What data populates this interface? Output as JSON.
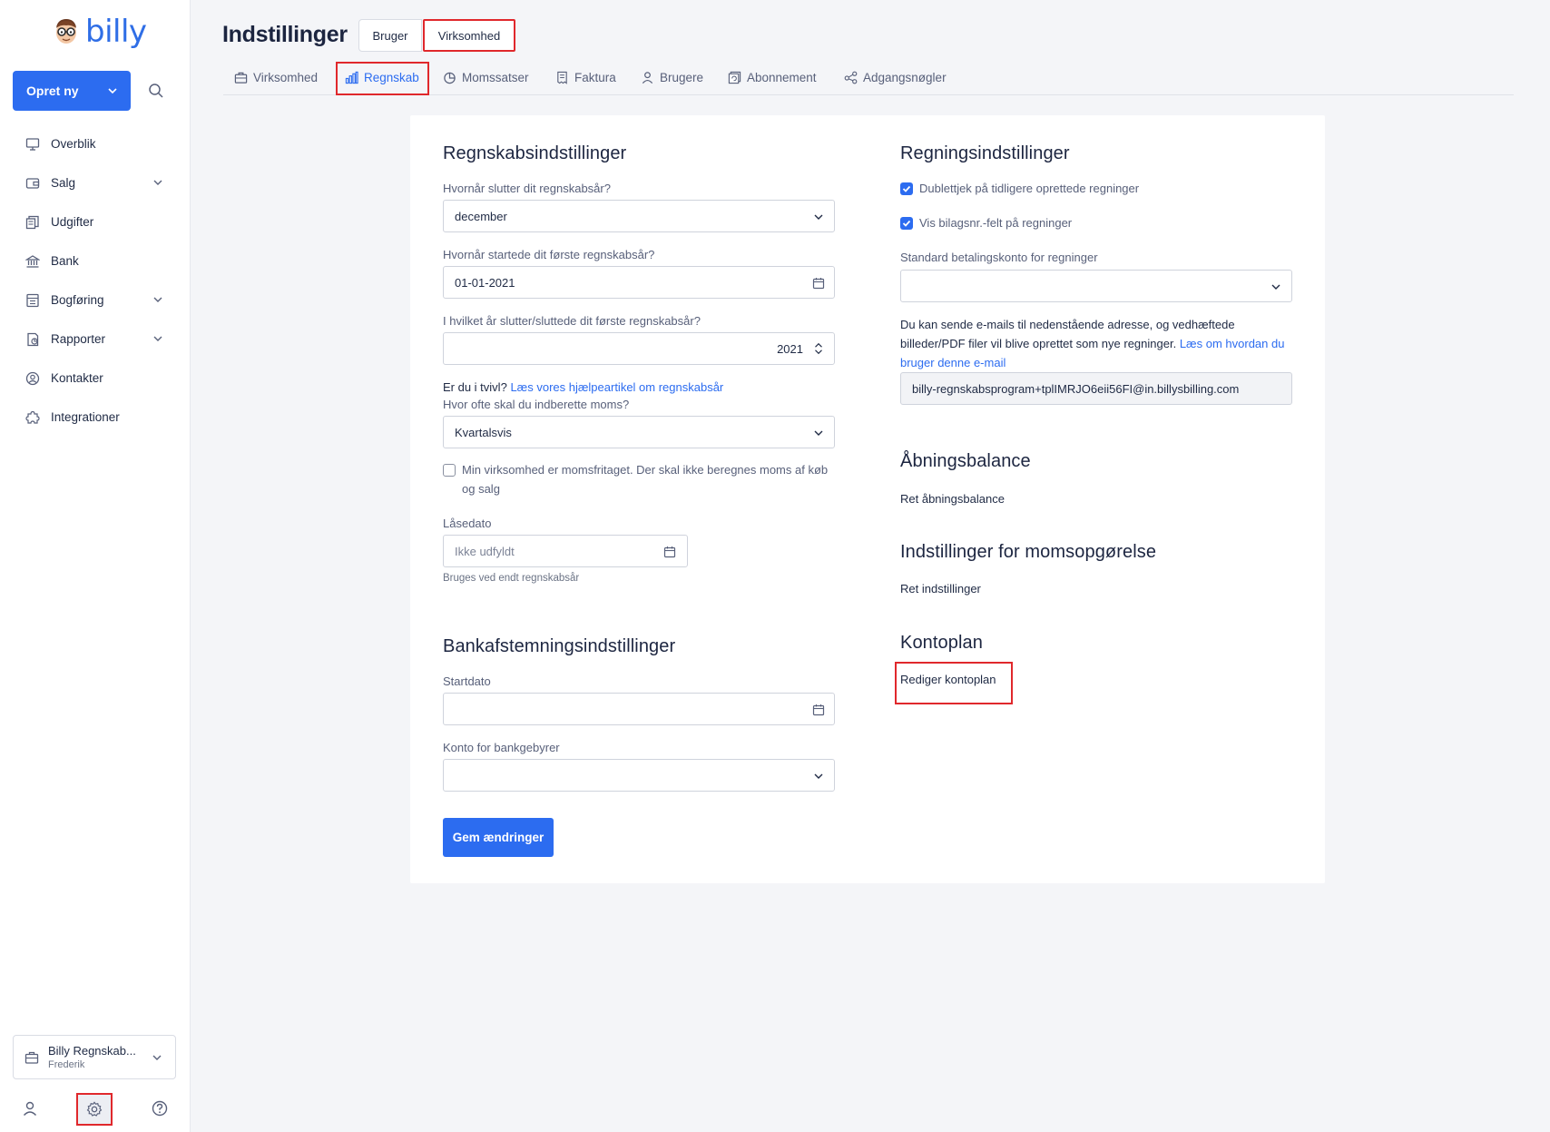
{
  "brand": {
    "name": "billy",
    "accent": "#2c6cf0",
    "highlight": "#e0282c"
  },
  "sidebar": {
    "create_label": "Opret ny",
    "items": [
      {
        "label": "Overblik",
        "icon": "monitor-icon",
        "has_chevron": false
      },
      {
        "label": "Salg",
        "icon": "wallet-icon",
        "has_chevron": true
      },
      {
        "label": "Udgifter",
        "icon": "receipts-icon",
        "has_chevron": false
      },
      {
        "label": "Bank",
        "icon": "bank-icon",
        "has_chevron": false
      },
      {
        "label": "Bogføring",
        "icon": "ledger-icon",
        "has_chevron": true
      },
      {
        "label": "Rapporter",
        "icon": "report-icon",
        "has_chevron": true
      },
      {
        "label": "Kontakter",
        "icon": "contact-icon",
        "has_chevron": false
      },
      {
        "label": "Integrationer",
        "icon": "puzzle-icon",
        "has_chevron": false
      }
    ],
    "org": {
      "name": "Billy Regnskab...",
      "user": "Frederik"
    }
  },
  "header": {
    "title": "Indstillinger",
    "segments": {
      "user": "Bruger",
      "company": "Virksomhed"
    }
  },
  "tabs": [
    {
      "label": "Virksomhed",
      "icon": "briefcase-icon",
      "active": false
    },
    {
      "label": "Regnskab",
      "icon": "bar-chart-icon",
      "active": true
    },
    {
      "label": "Momssatser",
      "icon": "pie-chart-icon",
      "active": false
    },
    {
      "label": "Faktura",
      "icon": "invoice-icon",
      "active": false
    },
    {
      "label": "Brugere",
      "icon": "user-icon",
      "active": false
    },
    {
      "label": "Abonnement",
      "icon": "subscription-icon",
      "active": false
    },
    {
      "label": "Adgangsnøgler",
      "icon": "share-key-icon",
      "active": false
    }
  ],
  "accounting": {
    "title": "Regnskabsindstillinger",
    "fiscal_end_label": "Hvornår slutter dit regnskabsår?",
    "fiscal_end_value": "december",
    "first_start_label": "Hvornår startede dit første regnskabsår?",
    "first_start_value": "01-01-2021",
    "first_end_year_label": "I hvilket år slutter/sluttede dit første regnskabsår?",
    "first_end_year_value": "2021",
    "doubt_text": "Er du i tvivl?",
    "doubt_link": "Læs vores hjælpeartikel om regnskabsår",
    "vat_freq_label": "Hvor ofte skal du indberette moms?",
    "vat_freq_value": "Kvartalsvis",
    "vat_exempt_line1": "Min virksomhed er momsfritaget. Der skal ikke beregnes moms af køb",
    "vat_exempt_line2": "og salg",
    "vat_exempt_checked": false,
    "lock_label": "Låsedato",
    "lock_placeholder": "Ikke udfyldt",
    "lock_help": "Bruges ved endt regnskabsår"
  },
  "bank_rec": {
    "title": "Bankafstemningsindstillinger",
    "start_label": "Startdato",
    "start_value": "",
    "fee_label": "Konto for bankgebyrer",
    "fee_value": ""
  },
  "save_label": "Gem ændringer",
  "bills": {
    "title": "Regningsindstillinger",
    "dup_check_label": "Dublettjek på tidligere oprettede regninger",
    "dup_check_checked": true,
    "voucher_label": "Vis bilagsnr.-felt på regninger",
    "voucher_checked": true,
    "pay_account_label": "Standard betalingskonto for regninger",
    "pay_account_value": "",
    "email_text_line1": "Du kan sende e-mails til nedenstående adresse, og vedhæftede",
    "email_text_line2": "billeder/PDF filer vil blive oprettet som nye regninger.",
    "email_link_part1": "Læs om hvordan du",
    "email_link_part2": "bruger denne e-mail",
    "email_address": "billy-regnskabsprogram+tplIMRJO6eii56FI@in.billysbilling.com"
  },
  "opening": {
    "title": "Åbningsbalance",
    "link": "Ret åbningsbalance"
  },
  "vat_report": {
    "title": "Indstillinger for momsopgørelse",
    "link": "Ret indstillinger"
  },
  "chart_of_accounts": {
    "title": "Kontoplan",
    "link": "Rediger kontoplan"
  }
}
